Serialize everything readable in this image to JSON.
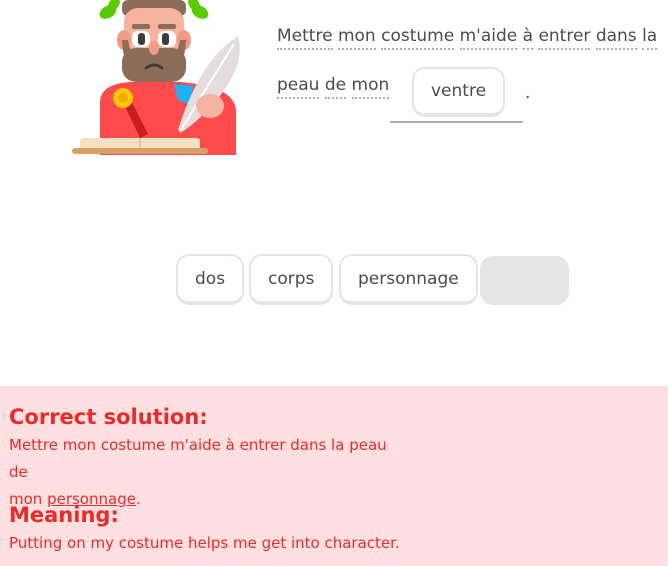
{
  "sentence": {
    "line1_words": [
      "Mettre",
      "mon",
      "costume",
      "m'aide",
      "à",
      "entrer",
      "dans",
      "la"
    ],
    "line2_words": [
      "peau",
      "de",
      "mon"
    ],
    "placed_answer": "ventre",
    "ending_punctuation": "."
  },
  "word_bank": {
    "tiles": [
      "dos",
      "corps",
      "personnage"
    ]
  },
  "feedback": {
    "solution_heading": "Correct solution:",
    "solution_line1": "Mettre mon costume m'aide à entrer dans la peau de",
    "solution_prefix": "mon ",
    "solution_answer": "personnage",
    "solution_suffix": ".",
    "meaning_heading": "Meaning:",
    "meaning_text": "Putting on my costume helps me get into character.",
    "status_color": "#ea2b2b",
    "panel_color": "#ffdfe0"
  },
  "illustration": {
    "icon": "laurel-wreath-writer-character-icon"
  }
}
